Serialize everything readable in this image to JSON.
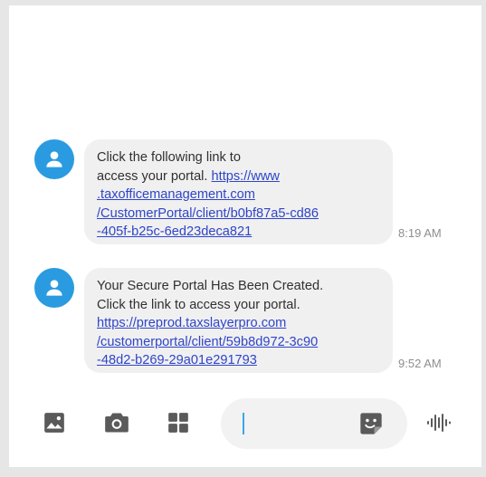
{
  "messages": [
    {
      "lines": [
        {
          "text": "Click the following link to",
          "is_link": false
        },
        {
          "text": "access your portal. ",
          "is_link": false,
          "link_suffix": "https://www"
        },
        {
          "text": ".taxofficemanagement.com",
          "is_link": true
        },
        {
          "text": "/CustomerPortal/client/b0bf87a5-cd86",
          "is_link": true
        },
        {
          "text": "-405f-b25c-6ed23deca821",
          "is_link": true
        }
      ],
      "time": "8:19 AM"
    },
    {
      "lines": [
        {
          "text": "Your Secure Portal Has Been Created.",
          "is_link": false
        },
        {
          "text": "Click the link to access your portal.",
          "is_link": false
        },
        {
          "text": "https://preprod.taxslayerpro.com",
          "is_link": true
        },
        {
          "text": "/customerportal/client/59b8d972-3c90",
          "is_link": true
        },
        {
          "text": "-48d2-b269-29a01e291793",
          "is_link": true
        }
      ],
      "time": "9:52 AM"
    }
  ],
  "composer": {
    "input_value": "",
    "input_placeholder": ""
  },
  "icons": {
    "avatar": "person-icon",
    "gallery": "image-icon",
    "camera": "camera-icon",
    "more": "grid-icon",
    "sticker": "sticker-icon",
    "voice": "voice-wave-icon"
  },
  "colors": {
    "avatar": "#2a9be0",
    "bubble": "#f0f0f0",
    "link": "#2f45c8",
    "timestamp": "#8e8e8e",
    "caret": "#3aa7e8",
    "icon": "#5a5a5a"
  }
}
